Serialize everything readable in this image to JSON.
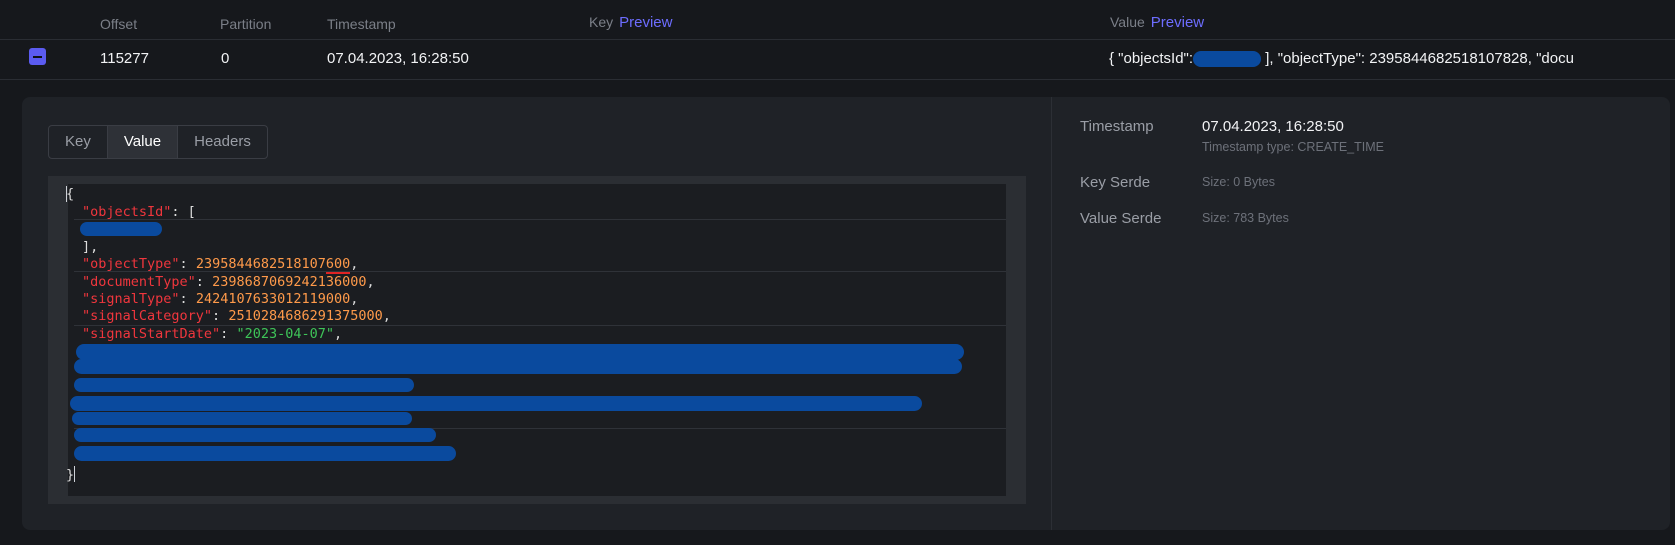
{
  "header": {
    "offset": "Offset",
    "partition": "Partition",
    "timestamp": "Timestamp",
    "key": "Key",
    "key_preview": "Preview",
    "value": "Value",
    "value_preview": "Preview"
  },
  "row": {
    "offset": "115277",
    "partition": "0",
    "timestamp": "07.04.2023, 16:28:50",
    "value_preview_a": "{ \"objectsId\":",
    "value_preview_b": " ], \"objectType\": 2395844682518107",
    "value_preview_c": "828",
    "value_preview_d": ", \"docu"
  },
  "tabs": [
    "Key",
    "Value",
    "Headers"
  ],
  "code": {
    "open_brace": "{",
    "objectsId_key": "\"objectsId\"",
    "objectsId_rest": ": [",
    "close_bracket": "],",
    "objectType_key": "\"objectType\"",
    "objectType_val_a": "2395844682518107",
    "objectType_val_b": "600",
    "documentType_key": "\"documentType\"",
    "documentType_val": "2398687069242136000",
    "signalType_key": "\"signalType\"",
    "signalType_val": "2424107633012119000",
    "signalCategory_key": "\"signalCategory\"",
    "signalCategory_val": "2510284686291375000",
    "signalStartDate_key": "\"signalStartDate\"",
    "signalStartDate_val": "\"2023-04-07\"",
    "colon": ": ",
    "comma": ",",
    "close_brace": "}"
  },
  "meta": {
    "timestamp_label": "Timestamp",
    "timestamp_value": "07.04.2023, 16:28:50",
    "timestamp_type": "Timestamp type: CREATE_TIME",
    "key_serde_label": "Key Serde",
    "key_serde_size": "Size: 0 Bytes",
    "value_serde_label": "Value Serde",
    "value_serde_size": "Size: 783 Bytes"
  },
  "colors": {
    "accent": "#5b5bf0",
    "link": "#6d6dff",
    "json_key": "#f0363d",
    "json_number": "#ff9a4a",
    "json_string": "#3ec458",
    "redaction": "#0a4a9e"
  }
}
